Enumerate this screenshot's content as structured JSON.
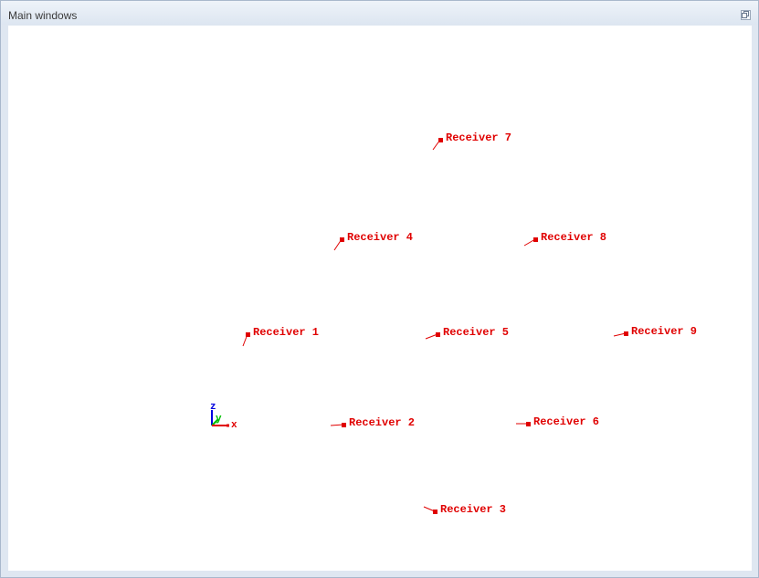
{
  "window": {
    "title": "Main windows"
  },
  "axes": {
    "x_label": "x",
    "y_label": "y",
    "z_label": "z",
    "colors": {
      "x": "#e00000",
      "y": "#00c000",
      "z": "#0000e0"
    }
  },
  "receivers": [
    {
      "label": "Receiver 1"
    },
    {
      "label": "Receiver 2"
    },
    {
      "label": "Receiver 3"
    },
    {
      "label": "Receiver 4"
    },
    {
      "label": "Receiver 5"
    },
    {
      "label": "Receiver 6"
    },
    {
      "label": "Receiver 7"
    },
    {
      "label": "Receiver 8"
    },
    {
      "label": "Receiver 9"
    }
  ],
  "colors": {
    "receiver": "#e00000",
    "window_frame": "#dfe7f1",
    "viewport_background": "#ffffff"
  }
}
